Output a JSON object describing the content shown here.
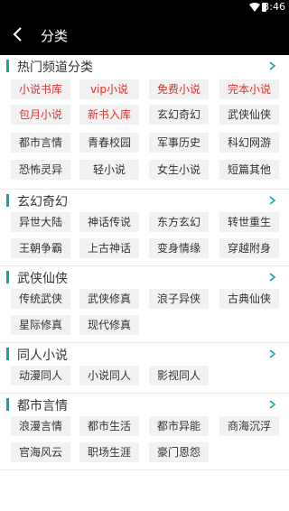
{
  "status_bar": {
    "time": "3:46"
  },
  "header": {
    "title": "分类"
  },
  "sections": [
    {
      "title": "热门频道分类",
      "tags": [
        {
          "label": "小说书库",
          "red": true
        },
        {
          "label": "vip小说",
          "red": true
        },
        {
          "label": "免费小说",
          "red": true
        },
        {
          "label": "完本小说",
          "red": true
        },
        {
          "label": "包月小说",
          "red": true
        },
        {
          "label": "新书入库",
          "red": true
        },
        {
          "label": "玄幻奇幻",
          "red": false
        },
        {
          "label": "武侠仙侠",
          "red": false
        },
        {
          "label": "都市言情",
          "red": false
        },
        {
          "label": "青春校园",
          "red": false
        },
        {
          "label": "军事历史",
          "red": false
        },
        {
          "label": "科幻网游",
          "red": false
        },
        {
          "label": "恐怖灵异",
          "red": false
        },
        {
          "label": "轻小说",
          "red": false
        },
        {
          "label": "女生小说",
          "red": false
        },
        {
          "label": "短篇其他",
          "red": false
        }
      ]
    },
    {
      "title": "玄幻奇幻",
      "tags": [
        {
          "label": "异世大陆",
          "red": false
        },
        {
          "label": "神话传说",
          "red": false
        },
        {
          "label": "东方玄幻",
          "red": false
        },
        {
          "label": "转世重生",
          "red": false
        },
        {
          "label": "王朝争霸",
          "red": false
        },
        {
          "label": "上古神话",
          "red": false
        },
        {
          "label": "变身情缘",
          "red": false
        },
        {
          "label": "穿越附身",
          "red": false
        }
      ]
    },
    {
      "title": "武侠仙侠",
      "tags": [
        {
          "label": "传统武侠",
          "red": false
        },
        {
          "label": "武侠修真",
          "red": false
        },
        {
          "label": "浪子异侠",
          "red": false
        },
        {
          "label": "古典仙侠",
          "red": false
        },
        {
          "label": "星际修真",
          "red": false
        },
        {
          "label": "现代修真",
          "red": false
        }
      ]
    },
    {
      "title": "同人小说",
      "tags": [
        {
          "label": "动漫同人",
          "red": false
        },
        {
          "label": "小说同人",
          "red": false
        },
        {
          "label": "影视同人",
          "red": false
        }
      ]
    },
    {
      "title": "都市言情",
      "tags": [
        {
          "label": "浪漫言情",
          "red": false
        },
        {
          "label": "都市生活",
          "red": false
        },
        {
          "label": "都市异能",
          "red": false
        },
        {
          "label": "商海沉浮",
          "red": false
        },
        {
          "label": "官海风云",
          "red": false
        },
        {
          "label": "职场生涯",
          "red": false
        },
        {
          "label": "豪门恩怨",
          "red": false
        }
      ]
    }
  ],
  "colors": {
    "accent_bar": "#11a5a8",
    "highlight_text": "#e0302c",
    "tag_bg": "#f2f2f2",
    "chrome": "#000000"
  },
  "icons": {
    "back": "arrow-left",
    "more": "chevron-right"
  }
}
